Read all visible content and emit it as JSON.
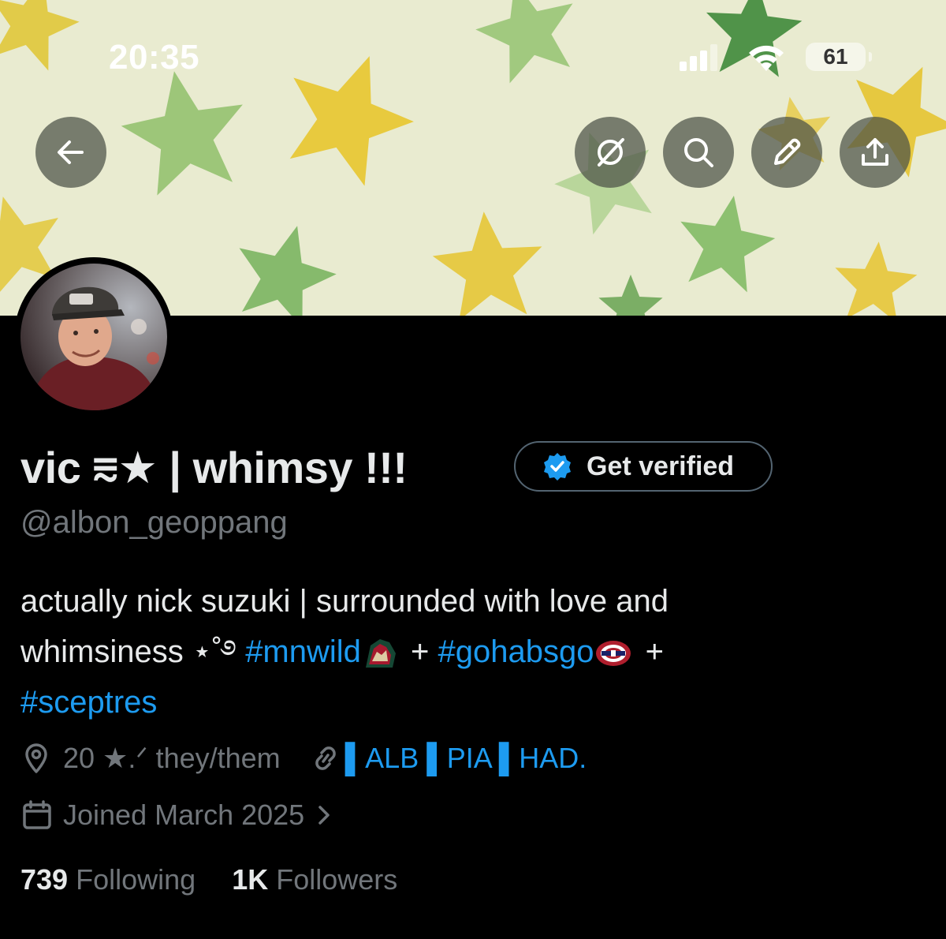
{
  "status_bar": {
    "time": "20:35",
    "battery": "61",
    "icons": [
      "signal-icon",
      "wifi-icon",
      "battery-icon"
    ]
  },
  "header_actions": {
    "back": "back-arrow-icon",
    "grok": "grok-icon",
    "search": "search-icon",
    "edit": "pencil-icon",
    "share": "share-icon"
  },
  "profile": {
    "name": "vic ⩳★ | whimsy !!!",
    "handle": "@albon_geoppang",
    "get_verified_label": "Get verified",
    "bio": {
      "line1": "actually nick suzuki | surrounded with love and",
      "line2_prefix": "whimsiness ⋆˚࿔ ",
      "tag1": "#mnwild",
      "plus1": " + ",
      "tag2": "#gohabsgo",
      "plus2": " + ",
      "tag3": "#sceptres"
    },
    "location": "20 ★.ᐟ they/them",
    "website": "▌ALB ▌PIA ▌HAD.",
    "joined": "Joined March 2025",
    "following_count": "739",
    "following_label": "Following",
    "followers_count": "1K",
    "followers_label": "Followers"
  },
  "colors": {
    "accent": "#1d9bf0",
    "muted": "#71767b",
    "text": "#e7e9ea",
    "background": "#000000",
    "banner_bg": "#e9ebd0"
  }
}
